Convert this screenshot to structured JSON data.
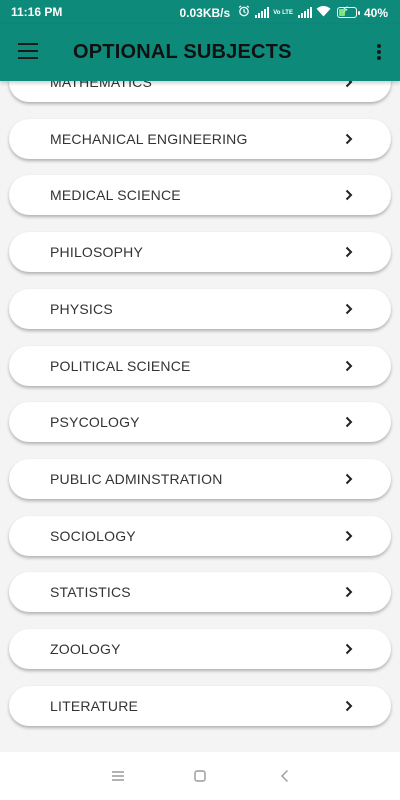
{
  "status_bar": {
    "time": "11:16 PM",
    "network_speed": "0.03KB/s",
    "volte": "Vo LTE",
    "battery_percent": "40%",
    "battery_level": 0.4,
    "icons": [
      "alarm-icon",
      "signal-icon",
      "volte-icon",
      "signal-icon",
      "wifi-icon",
      "battery-charging-icon"
    ]
  },
  "app_bar": {
    "title": "OPTIONAL SUBJECTS",
    "background_color": "#0e8a7b",
    "icons": [
      "hamburger-menu-icon",
      "more-vert-icon"
    ]
  },
  "subjects": [
    {
      "label": "MATHEMATICS"
    },
    {
      "label": "MECHANICAL ENGINEERING"
    },
    {
      "label": "MEDICAL SCIENCE"
    },
    {
      "label": "PHILOSOPHY"
    },
    {
      "label": "PHYSICS"
    },
    {
      "label": "POLITICAL SCIENCE"
    },
    {
      "label": "PSYCOLOGY"
    },
    {
      "label": "PUBLIC ADMINSTRATION"
    },
    {
      "label": "SOCIOLOGY"
    },
    {
      "label": "STATISTICS"
    },
    {
      "label": "ZOOLOGY"
    },
    {
      "label": "LITERATURE"
    }
  ],
  "nav_bar": {
    "icons": [
      "recents-icon",
      "home-icon",
      "back-icon"
    ]
  }
}
